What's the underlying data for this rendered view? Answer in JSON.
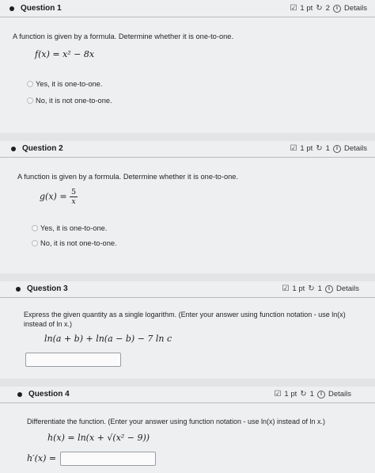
{
  "questions": [
    {
      "title": "Question 1",
      "points": "1 pt",
      "attempts": "2",
      "details": "Details",
      "prompt": "A function is given by a formula. Determine whether it is one-to-one.",
      "formula": "f(x) = x² − 8x",
      "options": [
        "Yes, it is one-to-one.",
        "No, it is not one-to-one."
      ]
    },
    {
      "title": "Question 2",
      "points": "1 pt",
      "attempts": "1",
      "details": "Details",
      "prompt": "A function is given by a formula. Determine whether it is one-to-one.",
      "formula_lhs": "g(x) =",
      "formula_num": "5",
      "formula_den": "x",
      "options": [
        "Yes, it is one-to-one.",
        "No, it is not one-to-one."
      ]
    },
    {
      "title": "Question 3",
      "points": "1 pt",
      "attempts": "1",
      "details": "Details",
      "prompt": "Express the given quantity as a single logarithm. (Enter your answer using function notation - use ln(x) instead of ln x.)",
      "formula": "ln(a + b) + ln(a − b) − 7 ln c"
    },
    {
      "title": "Question 4",
      "points": "1 pt",
      "attempts": "1",
      "details": "Details",
      "prompt": "Differentiate the function. (Enter your answer using function notation - use ln(x) instead of ln x.)",
      "formula": "h(x) = ln(x + √(x² − 9))",
      "answer_label": "h′(x) ="
    }
  ],
  "icons": {
    "points": "edit-check-icon",
    "attempts": "retry-icon",
    "details": "info-icon"
  }
}
